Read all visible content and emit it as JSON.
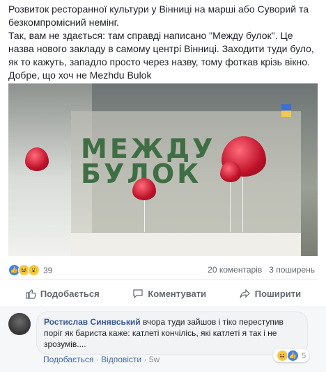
{
  "post": {
    "paragraphs": [
      "Розвиток ресторанної культури у Вінниці на марші або Суворий та безкомпромісний немінг.",
      "Так, вам не здається: там справді написано \"Между булок\". Це назва нового закладу в самому центрі Вінниці. Заходити туди було, як то кажуть, западло просто через назву, тому фоткав крізь вікно.",
      "Добре, що хоч не Mezhdu Bulok"
    ],
    "photo_sign_line1": "МЕЖДУ",
    "photo_sign_line2": "БУЛОК"
  },
  "stats": {
    "reaction_count": "39",
    "comments": "20 коментарів",
    "shares": "3 поширень"
  },
  "actions": {
    "like": "Подобається",
    "comment": "Коментувати",
    "share": "Поширити"
  },
  "comment": {
    "author": "Ростислав Синявський",
    "text": "вчора туди зайшов і тіко переступив поріг як бариста каже: катлеті кончілісь, які катлеті я так і не зрозумів....",
    "like": "Подобається",
    "reply": "Відповісти",
    "time": "5w",
    "reaction_count": "5"
  },
  "colors": {
    "link": "#385898",
    "like_blue": "#4267b2"
  }
}
